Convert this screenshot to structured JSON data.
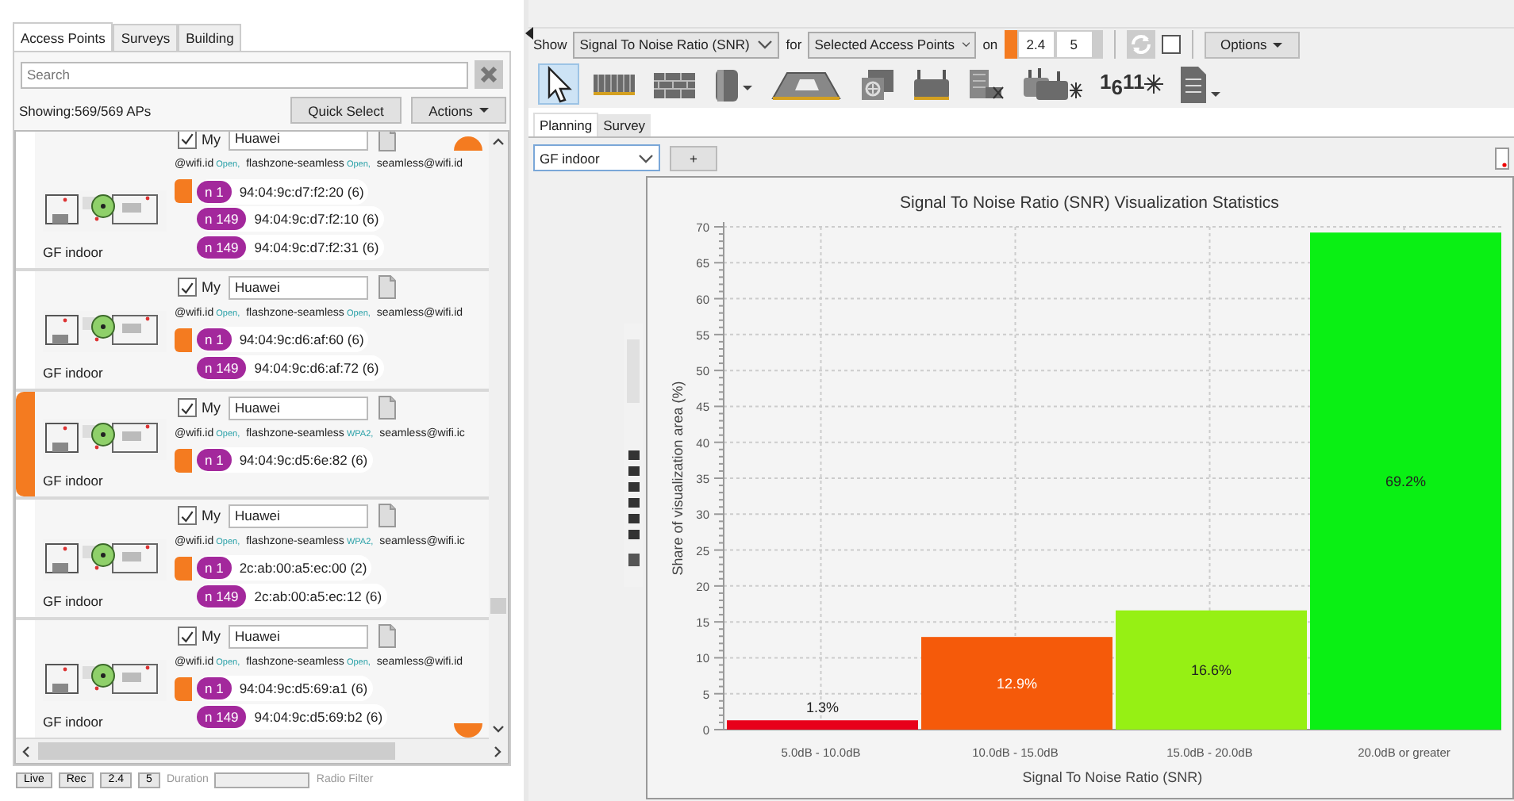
{
  "left_panel": {
    "tabs": [
      {
        "label": "Access Points",
        "selected": true
      },
      {
        "label": "Surveys",
        "selected": false
      },
      {
        "label": "Building",
        "selected": false
      }
    ],
    "search": {
      "placeholder": "Search"
    },
    "count": "Showing:569/569 APs",
    "quick_select": "Quick Select",
    "actions": "Actions",
    "scroll_markers": {
      "top": true,
      "bottom": true
    },
    "access_points": [
      {
        "selected": false,
        "my_label": "My",
        "my_checked": true,
        "vendor": "Huawei",
        "floor": "GF indoor",
        "ssids": [
          {
            "name": "@wifi.id",
            "security": "Open,"
          },
          {
            "name": "flashzone-seamless",
            "security": "Open,"
          },
          {
            "name": "seamless@wifi.id"
          }
        ],
        "radios": [
          {
            "active": true,
            "channel": "n 1",
            "mac": "94:04:9c:d7:f2:20 (6)"
          },
          {
            "active": false,
            "channel": "n 149",
            "mac": "94:04:9c:d7:f2:10 (6)"
          },
          {
            "active": false,
            "channel": "n 149",
            "mac": "94:04:9c:d7:f2:31 (6)"
          }
        ]
      },
      {
        "selected": false,
        "my_label": "My",
        "my_checked": true,
        "vendor": "Huawei",
        "floor": "GF indoor",
        "ssids": [
          {
            "name": "@wifi.id",
            "security": "Open,"
          },
          {
            "name": "flashzone-seamless",
            "security": "Open,"
          },
          {
            "name": "seamless@wifi.id"
          }
        ],
        "radios": [
          {
            "active": true,
            "channel": "n 1",
            "mac": "94:04:9c:d6:af:60 (6)"
          },
          {
            "active": false,
            "channel": "n 149",
            "mac": "94:04:9c:d6:af:72 (6)"
          }
        ]
      },
      {
        "selected": true,
        "my_label": "My",
        "my_checked": true,
        "vendor": "Huawei",
        "floor": "GF indoor",
        "ssids": [
          {
            "name": "@wifi.id",
            "security": "Open,"
          },
          {
            "name": "flashzone-seamless",
            "security": "WPA2,"
          },
          {
            "name": "seamless@wifi.ic"
          }
        ],
        "radios": [
          {
            "active": true,
            "channel": "n 1",
            "mac": "94:04:9c:d5:6e:82 (6)"
          }
        ]
      },
      {
        "selected": false,
        "my_label": "My",
        "my_checked": true,
        "vendor": "Huawei",
        "floor": "GF indoor",
        "ssids": [
          {
            "name": "@wifi.id",
            "security": "Open,"
          },
          {
            "name": "flashzone-seamless",
            "security": "WPA2,"
          },
          {
            "name": "seamless@wifi.ic"
          }
        ],
        "radios": [
          {
            "active": true,
            "channel": "n 1",
            "mac": "2c:ab:00:a5:ec:00 (2)"
          },
          {
            "active": false,
            "channel": "n 149",
            "mac": "2c:ab:00:a5:ec:12 (6)"
          }
        ]
      },
      {
        "selected": false,
        "my_label": "My",
        "my_checked": true,
        "vendor": "Huawei",
        "floor": "GF indoor",
        "ssids": [
          {
            "name": "@wifi.id",
            "security": "Open,"
          },
          {
            "name": "flashzone-seamless",
            "security": "Open,"
          },
          {
            "name": "seamless@wifi.id"
          }
        ],
        "radios": [
          {
            "active": true,
            "channel": "n 1",
            "mac": "94:04:9c:d5:69:a1 (6)"
          },
          {
            "active": false,
            "channel": "n 149",
            "mac": "94:04:9c:d5:69:b2 (6)"
          }
        ]
      }
    ]
  },
  "bottom_bar": {
    "modes": [
      "Live",
      "Rec"
    ],
    "bands": [
      "2.4",
      "5"
    ],
    "duration_label": "Duration",
    "radio_filter_label": "Radio Filter"
  },
  "toolbar": {
    "show_label": "Show",
    "metric": "Signal To Noise Ratio (SNR)",
    "for_label": "for",
    "target": "Selected Access Points",
    "on_label": "on",
    "bands": [
      "2.4",
      "5"
    ],
    "auto_checked": false,
    "options": "Options"
  },
  "tools": [
    {
      "kind": "pointer",
      "selected": true
    },
    {
      "kind": "wall",
      "selected": false
    },
    {
      "kind": "brick",
      "selected": false
    },
    {
      "kind": "pillar",
      "selected": false
    },
    {
      "kind": "floor",
      "selected": false
    },
    {
      "kind": "ap_add",
      "selected": false
    },
    {
      "kind": "router",
      "selected": false
    },
    {
      "kind": "router_x",
      "selected": false
    },
    {
      "kind": "routers",
      "selected": false
    },
    {
      "kind": "channels",
      "selected": false,
      "label": "1$_{6}$11"
    },
    {
      "kind": "document",
      "selected": false
    }
  ],
  "view_tabs": [
    {
      "label": "Planning",
      "selected": true
    },
    {
      "label": "Survey",
      "selected": false
    }
  ],
  "floor_select": "GF indoor",
  "add_button": "+",
  "chart_window": {
    "chart_data": {
      "type": "bar",
      "title": "Signal To Noise Ratio (SNR) Visualization Statistics",
      "xlabel": "Signal To Noise Ratio (SNR)",
      "ylabel": "Share of visualization area (%)",
      "categories": [
        "5.0dB - 10.0dB",
        "10.0dB - 15.0dB",
        "15.0dB - 20.0dB",
        "20.0dB or greater"
      ],
      "series": [
        {
          "color": "#e8001a",
          "values": [
            1.3,
            null,
            null,
            null
          ]
        },
        {
          "color": "#f55a0a",
          "values": [
            null,
            12.9,
            null,
            null
          ]
        },
        {
          "color": "#96f014",
          "values": [
            null,
            null,
            16.6,
            null
          ]
        },
        {
          "color": "#0af014",
          "values": [
            null,
            null,
            null,
            69.2
          ]
        }
      ],
      "grid": true,
      "ylim": [
        0,
        70
      ],
      "yticks": [
        0,
        5,
        10,
        15,
        20,
        25,
        30,
        35,
        40,
        45,
        50,
        55,
        60,
        65,
        70
      ],
      "value_labels": [
        "1.3%",
        "12.9%",
        "16.6%",
        "69.2%"
      ]
    }
  }
}
